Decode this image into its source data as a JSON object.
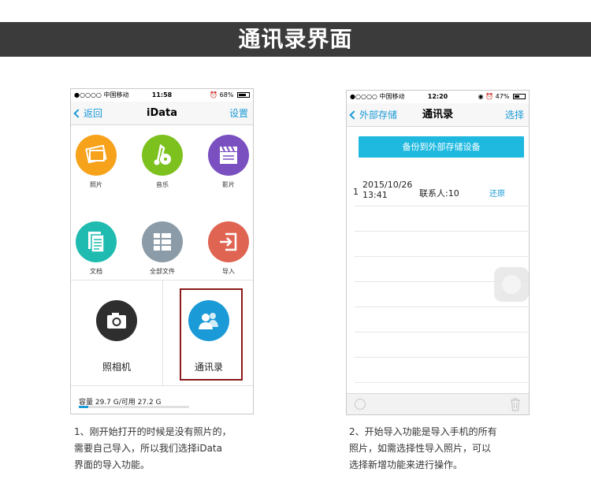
{
  "banner": {
    "title": "通讯录界面"
  },
  "screen1": {
    "status": {
      "carrier": "●○○○○ 中国移动",
      "time": "11:58",
      "battery": "68%"
    },
    "nav": {
      "back": "返回",
      "title": "iData",
      "right": "设置"
    },
    "grid": [
      {
        "label": "照片",
        "color": "#f7a21b",
        "icon": "photo-icon"
      },
      {
        "label": "音乐",
        "color": "#7dc11f",
        "icon": "music-icon"
      },
      {
        "label": "影片",
        "color": "#7a4fc0",
        "icon": "film-icon"
      },
      {
        "label": "文档",
        "color": "#1fbbb0",
        "icon": "document-icon"
      },
      {
        "label": "全部文件",
        "color": "#8b9ca8",
        "icon": "all-files-icon"
      },
      {
        "label": "导入",
        "color": "#e06452",
        "icon": "import-icon"
      }
    ],
    "camera": {
      "label": "照相机",
      "color": "#2e2e2e",
      "icon": "camera-icon"
    },
    "contacts": {
      "label": "通讯录",
      "color": "#1a9ad6",
      "icon": "contacts-icon"
    },
    "storage": {
      "text": "容量 29.7 G/可用 27.2 G",
      "used_fraction": 0.084
    }
  },
  "screen2": {
    "status": {
      "carrier": "●○○○○ 中国移动",
      "time": "12:20",
      "battery": "47%"
    },
    "nav": {
      "back": "外部存储",
      "title": "通讯录",
      "right": "选择"
    },
    "backup_button": "备份到外部存储设备",
    "record": {
      "index": "1",
      "date": "2015/10/26",
      "time": "13:41",
      "contacts": "联系人:10",
      "action": "还原"
    }
  },
  "captions": {
    "left": [
      "1、刚开始打开的时候是没有照片的，",
      "需要自己导入，所以我们选择iData",
      "界面的导入功能。"
    ],
    "right": [
      "2、开始导入功能是导入手机的所有",
      "照片，如需选择性导入照片，可以",
      "选择新增功能来进行操作。"
    ]
  }
}
